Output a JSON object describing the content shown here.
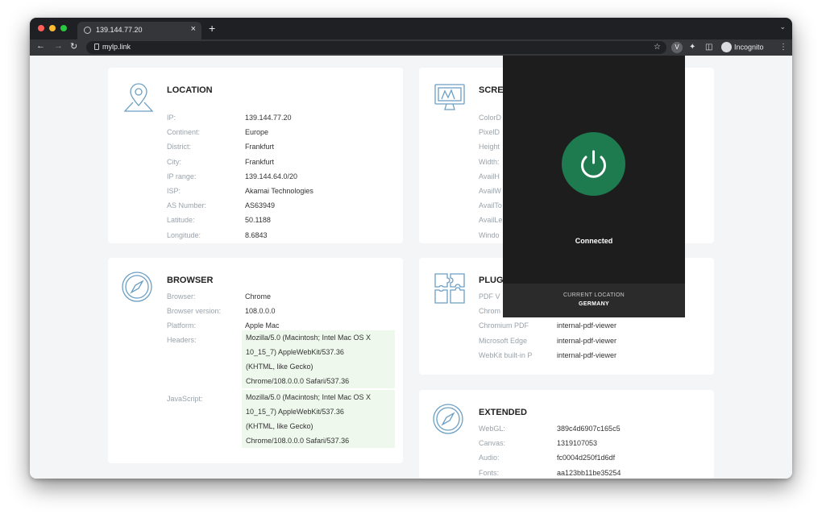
{
  "browser": {
    "tab_title": "139.144.77.20",
    "tab_close": "×",
    "new_tab": "+",
    "url": "mylp.link",
    "extension_badge": "V",
    "profile_label": "Incognito"
  },
  "location": {
    "title": "LOCATION",
    "rows": [
      {
        "label": "IP:",
        "value": "139.144.77.20"
      },
      {
        "label": "Continent:",
        "value": "Europe"
      },
      {
        "label": "District:",
        "value": "Frankfurt"
      },
      {
        "label": "City:",
        "value": "Frankfurt"
      },
      {
        "label": "IP range:",
        "value": "139.144.64.0/20"
      },
      {
        "label": "ISP:",
        "value": "Akamai Technologies"
      },
      {
        "label": "AS Number:",
        "value": "AS63949"
      },
      {
        "label": "Latitude:",
        "value": "50.1188"
      },
      {
        "label": "Longitude:",
        "value": "8.6843"
      }
    ]
  },
  "browser_info": {
    "title": "BROWSER",
    "rows": [
      {
        "label": "Browser:",
        "value": "Chrome"
      },
      {
        "label": "Browser version:",
        "value": "108.0.0.0"
      },
      {
        "label": "Platform:",
        "value": "Apple Mac"
      }
    ],
    "headers_label": "Headers:",
    "headers_lines": [
      "Mozilla/5.0 (Macintosh; Intel Mac OS X",
      "10_15_7) AppleWebKit/537.36",
      "(KHTML, like Gecko)",
      "Chrome/108.0.0.0 Safari/537.36"
    ],
    "javascript_label": "JavaScript:",
    "javascript_lines": [
      "Mozilla/5.0 (Macintosh; Intel Mac OS X",
      "10_15_7) AppleWebKit/537.36",
      "(KHTML, like Gecko)",
      "Chrome/108.0.0.0 Safari/537.36"
    ]
  },
  "screen": {
    "title": "SCRE",
    "rows": [
      {
        "label": "ColorD"
      },
      {
        "label": "PixelD"
      },
      {
        "label": "Height"
      },
      {
        "label": "Width:"
      },
      {
        "label": "AvailH"
      },
      {
        "label": "AvailW"
      },
      {
        "label": "AvailTo"
      },
      {
        "label": "AvailLe"
      },
      {
        "label": "Windo"
      }
    ]
  },
  "plugins": {
    "title": "PLUG",
    "rows": [
      {
        "label": "PDF V",
        "value": ""
      },
      {
        "label": "Chrom",
        "value": ""
      },
      {
        "label": "Chromium PDF",
        "value": "internal-pdf-viewer"
      },
      {
        "label": "Microsoft Edge",
        "value": "internal-pdf-viewer"
      },
      {
        "label": "WebKit built-in P",
        "value": "internal-pdf-viewer"
      }
    ]
  },
  "extended": {
    "title": "EXTENDED",
    "rows": [
      {
        "label": "WebGL:",
        "value": "389c4d6907c165c5"
      },
      {
        "label": "Canvas:",
        "value": "1319107053"
      },
      {
        "label": "Audio:",
        "value": "fc0004d250f1d6df"
      },
      {
        "label": "Fonts:",
        "value": "aa123bb11be35254"
      }
    ]
  },
  "vpn": {
    "status": "Connected",
    "location_label": "CURRENT LOCATION",
    "location_value": "GERMANY"
  },
  "colors": {
    "vpn_power": "#1e7a4f",
    "header_highlight": "#eef8ec",
    "icon_stroke": "#6b9fc4"
  }
}
